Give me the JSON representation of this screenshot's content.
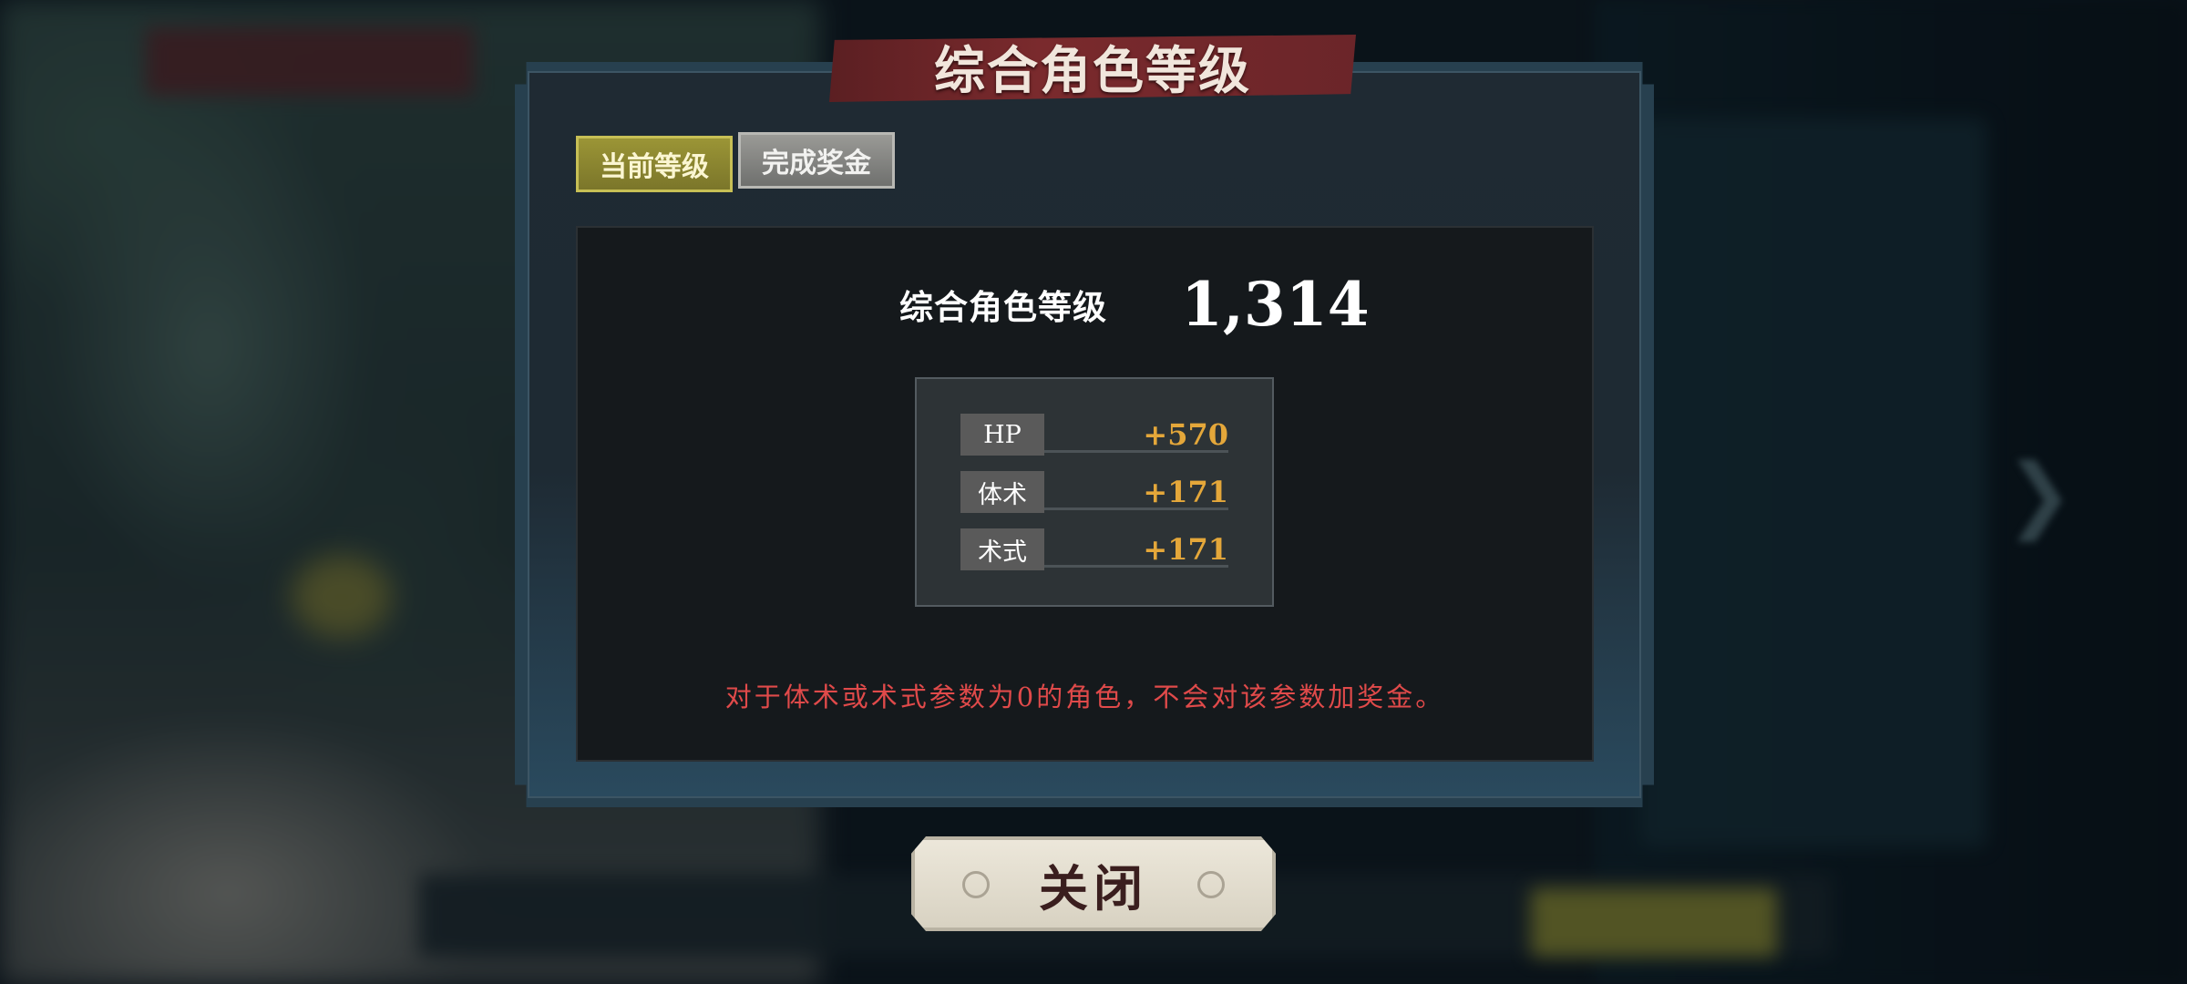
{
  "dialog": {
    "title": "综合角色等级",
    "tabs": [
      {
        "label": "当前等级",
        "active": true
      },
      {
        "label": "完成奖金",
        "active": false
      }
    ],
    "level": {
      "label": "综合角色等级",
      "value": "1,314"
    },
    "stats": [
      {
        "name": "HP",
        "value": "+570"
      },
      {
        "name": "体术",
        "value": "+171"
      },
      {
        "name": "术式",
        "value": "+171"
      }
    ],
    "notice": "对于体术或术式参数为0的角色，不会对该参数加奖金。"
  },
  "close_button": {
    "label": "关闭"
  },
  "colors": {
    "stat_value": "#e4a73a",
    "notice": "#e04a4a",
    "title_banner": "#7a2a2d",
    "active_tab": "#9b9536"
  }
}
